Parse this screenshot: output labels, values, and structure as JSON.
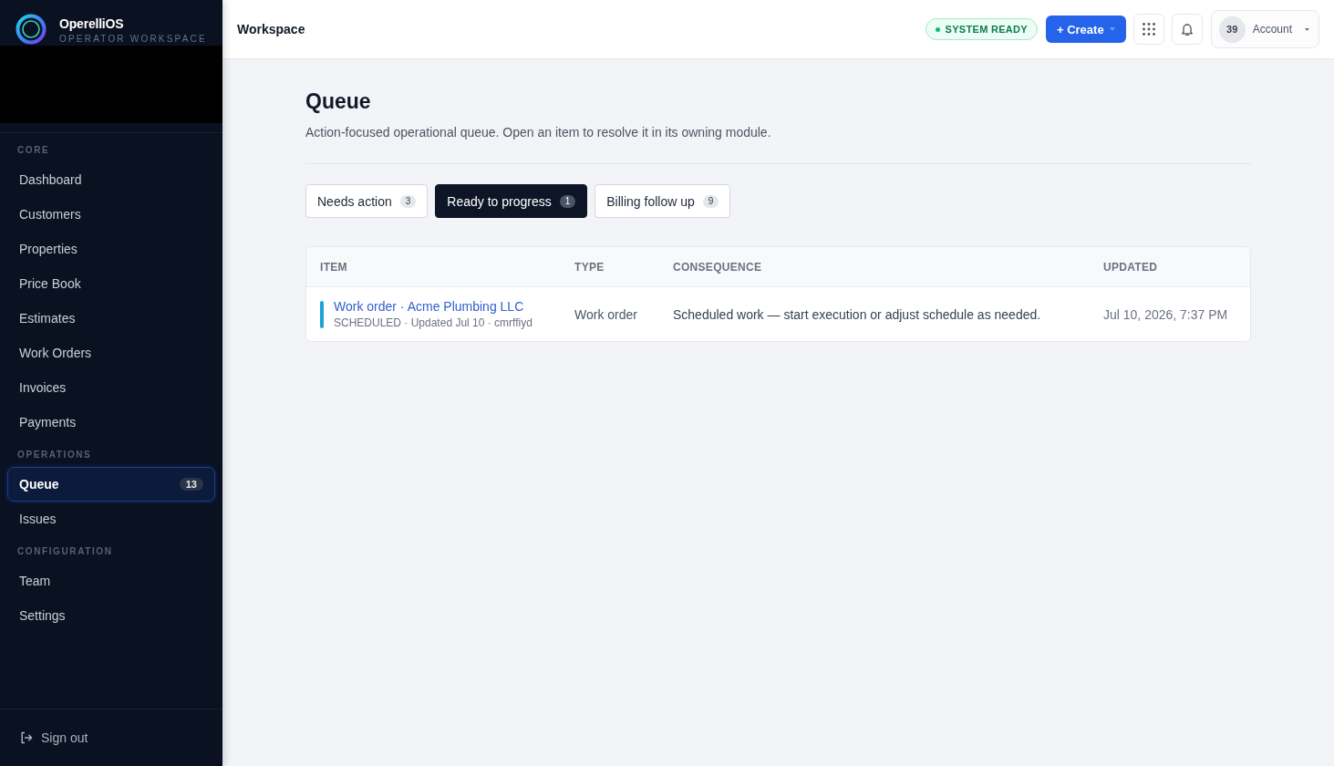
{
  "sidebar": {
    "brand": {
      "name": "OperelliOS",
      "subtitle": "OPERATOR WORKSPACE"
    },
    "sections": [
      {
        "label": "CORE",
        "items": [
          {
            "label": "Dashboard",
            "selected": false
          },
          {
            "label": "Customers",
            "selected": false
          },
          {
            "label": "Properties",
            "selected": false
          },
          {
            "label": "Price Book",
            "selected": false
          },
          {
            "label": "Estimates",
            "selected": false
          },
          {
            "label": "Work Orders",
            "selected": false
          },
          {
            "label": "Invoices",
            "selected": false
          },
          {
            "label": "Payments",
            "selected": false
          }
        ]
      },
      {
        "label": "OPERATIONS",
        "items": [
          {
            "label": "Queue",
            "selected": true,
            "badge": "13"
          },
          {
            "label": "Issues",
            "selected": false
          }
        ]
      },
      {
        "label": "CONFIGURATION",
        "items": [
          {
            "label": "Team",
            "selected": false
          },
          {
            "label": "Settings",
            "selected": false
          }
        ]
      }
    ],
    "sign_out": "Sign out"
  },
  "header": {
    "title": "Workspace",
    "status": "SYSTEM READY",
    "create_button": "+ Create",
    "account": {
      "avatar": "39",
      "label": "Account"
    }
  },
  "page": {
    "title": "Queue",
    "description": "Action-focused operational queue. Open an item to resolve it in its owning module.",
    "tabs": [
      {
        "label": "Needs action",
        "count": "3",
        "selected": false
      },
      {
        "label": "Ready to progress",
        "count": "1",
        "selected": true
      },
      {
        "label": "Billing follow up",
        "count": "9",
        "selected": false
      }
    ],
    "table": {
      "columns": [
        "ITEM",
        "TYPE",
        "CONSEQUENCE",
        "UPDATED"
      ],
      "rows": [
        {
          "title": "Work order · Acme Plumbing LLC",
          "meta": "SCHEDULED · Updated Jul 10 · cmrffiyd",
          "color": "#1ba3d8",
          "type": "Work order",
          "consequence": "Scheduled work — start execution or adjust schedule as needed.",
          "updated": "Jul 10, 2026, 7:37 PM"
        }
      ]
    }
  }
}
